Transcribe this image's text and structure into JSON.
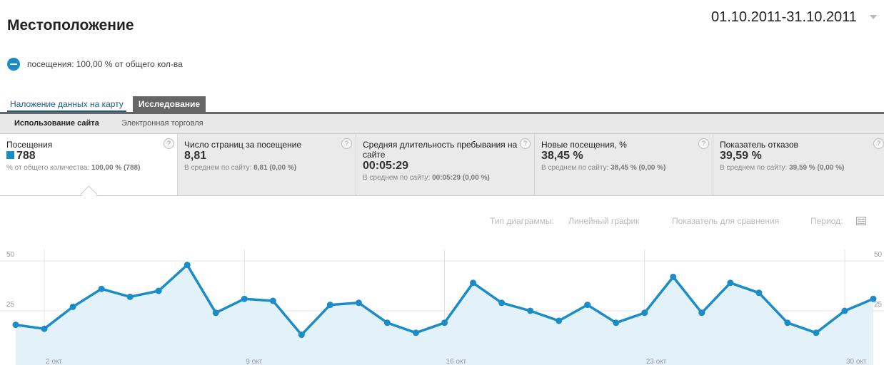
{
  "header": {
    "title": "Местоположение",
    "date_range": "01.10.2011-31.10.2011"
  },
  "segment": {
    "label": "посещения: 100,00 % от общего кол-ва",
    "icon": "minus-circle-icon",
    "color": "#1a8cc8"
  },
  "view_tabs": [
    {
      "label": "Наложение данных на карту",
      "active": false
    },
    {
      "label": "Исследование",
      "active": true
    }
  ],
  "sub_tabs": [
    {
      "label": "Использование сайта",
      "active": true
    },
    {
      "label": "Электронная торговля",
      "active": false
    }
  ],
  "metrics": [
    {
      "label": "Посещения",
      "value": "788",
      "sub_prefix": "% от общего количества: ",
      "sub_value": "100,00 % (788)",
      "selected": true
    },
    {
      "label": "Число страниц за посещение",
      "value": "8,81",
      "sub_prefix": "В среднем по сайту: ",
      "sub_value": "8,81 (0,00 %)"
    },
    {
      "label": "Средняя длительность пребывания на сайте",
      "value": "00:05:29",
      "sub_prefix": "В среднем по сайту: ",
      "sub_value": "00:05:29 (0,00 %)"
    },
    {
      "label": "Новые посещения, %",
      "value": "38,45 %",
      "sub_prefix": "В среднем по сайту: ",
      "sub_value": "38,45 % (0,00 %)"
    },
    {
      "label": "Показатель отказов",
      "value": "39,59 %",
      "sub_prefix": "В среднем по сайту: ",
      "sub_value": "39,59 % (0,00 %)"
    }
  ],
  "help_symbol": "?",
  "chart_options": {
    "type_label": "Тип диаграммы:",
    "type_value": "Линейный график",
    "compare": "Показатель для сравнения",
    "period": "Период:",
    "period_icon": "calendar-icon"
  },
  "chart_data": {
    "type": "area",
    "x": [
      1,
      2,
      3,
      4,
      5,
      6,
      7,
      8,
      9,
      10,
      11,
      12,
      13,
      14,
      15,
      16,
      17,
      18,
      19,
      20,
      21,
      22,
      23,
      24,
      25,
      26,
      27,
      28,
      29,
      30,
      31
    ],
    "series": [
      {
        "values": [
          18,
          16,
          27,
          36,
          32,
          35,
          48,
          24,
          31,
          30,
          13,
          28,
          29,
          19,
          14,
          19,
          39,
          29,
          25,
          20,
          28,
          19,
          24,
          42,
          24,
          39,
          34,
          19,
          14,
          25,
          31
        ]
      }
    ],
    "ylim": [
      0,
      50
    ],
    "yticks": [
      "50",
      "25"
    ],
    "xticks": [
      {
        "day": 2,
        "label": "2 окт"
      },
      {
        "day": 9,
        "label": "9 окт"
      },
      {
        "day": 16,
        "label": "16 окт"
      },
      {
        "day": 23,
        "label": "23 окт"
      },
      {
        "day": 30,
        "label": "30 окт"
      }
    ],
    "grid": true,
    "line_color": "#1a8cc8",
    "fill_color": "#e3f1f8"
  }
}
